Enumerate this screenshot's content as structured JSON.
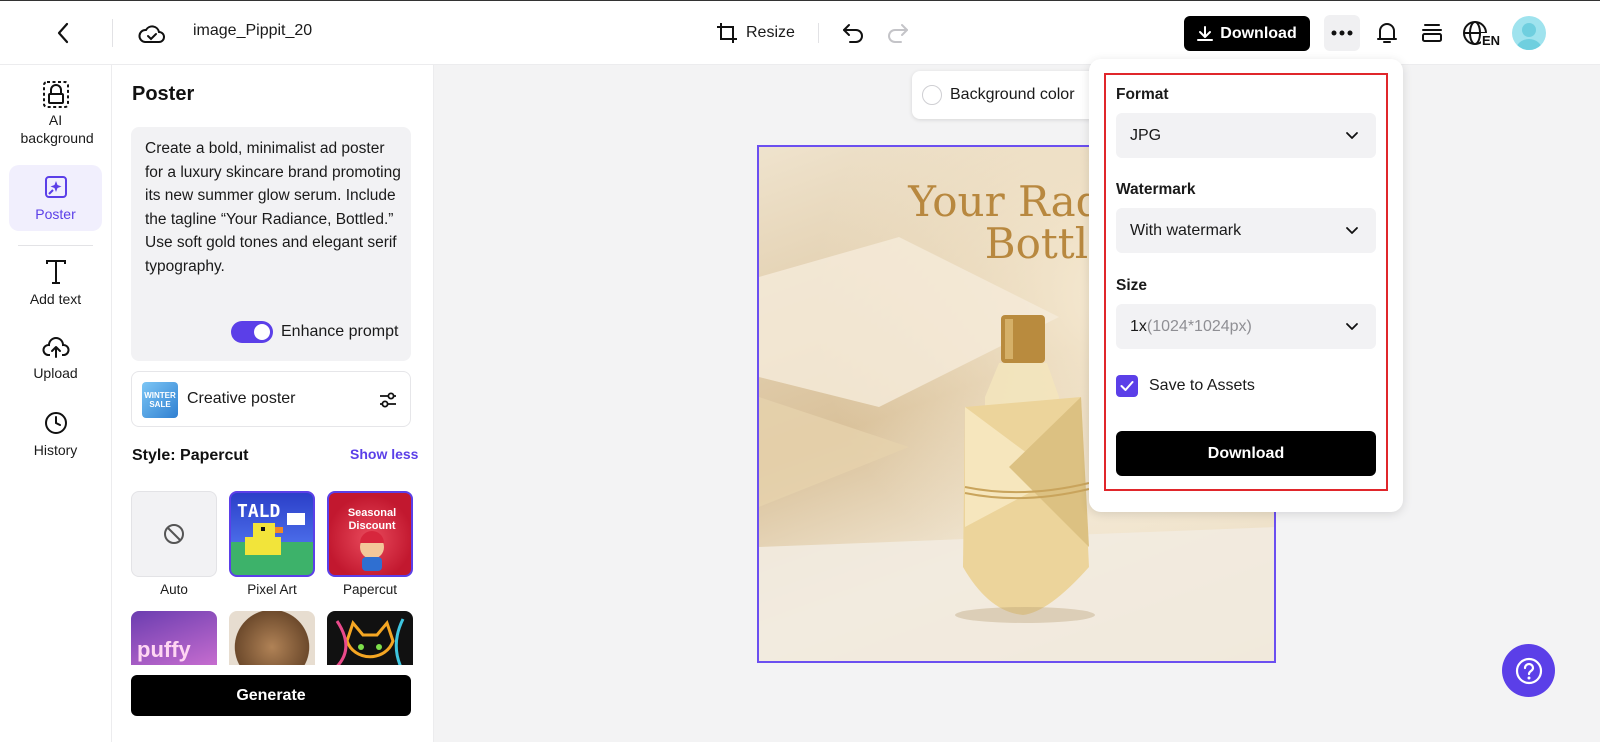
{
  "topbar": {
    "filename": "image_Pippit_20",
    "resize_label": "Resize",
    "download_label": "Download",
    "lang_code": "EN"
  },
  "rail": {
    "items": [
      {
        "label": "AI background",
        "icon": "ai-background-icon"
      },
      {
        "label": "Poster",
        "icon": "poster-icon"
      },
      {
        "label": "Add text",
        "icon": "text-icon"
      },
      {
        "label": "Upload",
        "icon": "upload-icon"
      },
      {
        "label": "History",
        "icon": "history-icon"
      }
    ]
  },
  "panel": {
    "title": "Poster",
    "prompt": "Create a bold, minimalist ad poster for a luxury skincare brand promoting its new summer glow serum. Include the tagline “Your Radiance, Bottled.” Use soft gold tones and elegant serif typography.",
    "enhance_label": "Enhance prompt",
    "creative_label": "Creative poster",
    "creative_thumb_text": "WINTER SALE",
    "style_title": "Style: Papercut",
    "show_less": "Show less",
    "styles": [
      {
        "label": "Auto"
      },
      {
        "label": "Pixel Art",
        "thumb_text": "TALD"
      },
      {
        "label": "Papercut",
        "thumb_text": "Seasonal Discount"
      },
      {
        "label": "",
        "thumb_text": "puffy"
      },
      {
        "label": ""
      },
      {
        "label": ""
      }
    ],
    "generate_label": "Generate"
  },
  "canvas": {
    "bg_color_label": "Background color",
    "poster_title": "Your Radiance,\nBottled."
  },
  "download_popover": {
    "format_label": "Format",
    "format_value": "JPG",
    "watermark_label": "Watermark",
    "watermark_value": "With watermark",
    "size_label": "Size",
    "size_value_main": "1x",
    "size_value_detail": "(1024*1024px)",
    "save_label": "Save to Assets",
    "download_label": "Download"
  },
  "colors": {
    "accent": "#5b3fe8",
    "highlight_frame": "#e0262b",
    "poster_text": "#b8883f"
  }
}
